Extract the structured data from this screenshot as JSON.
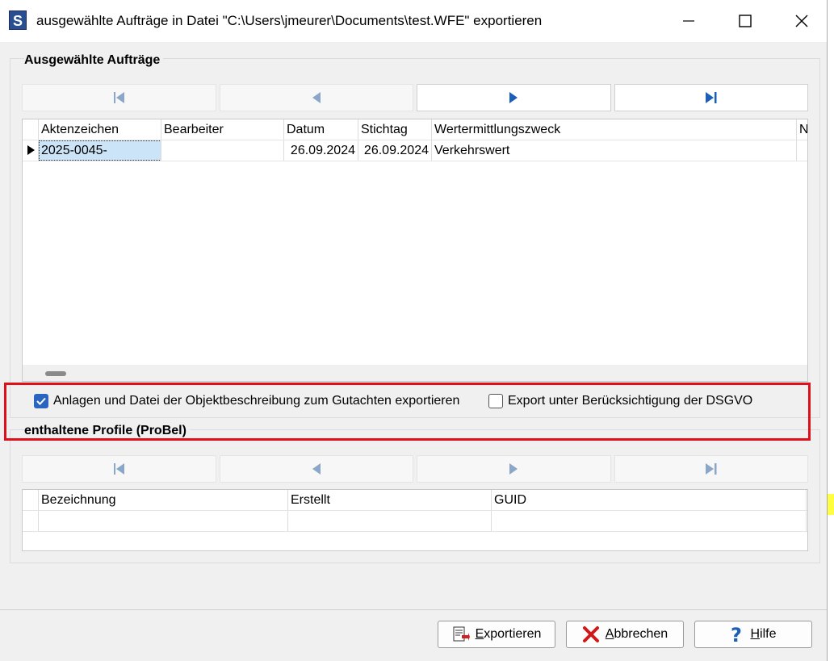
{
  "window": {
    "title": "ausgewählte Aufträge in Datei \"C:\\Users\\jmeurer\\Documents\\test.WFE\" exportieren",
    "app_icon_letter": "S"
  },
  "auftraege": {
    "section_title": "Ausgewählte Aufträge",
    "columns": [
      "Aktenzeichen",
      "Bearbeiter",
      "Datum",
      "Stichtag",
      "Wertermittlungszweck",
      "N"
    ],
    "rows": [
      {
        "aktenzeichen": "2025-0045-",
        "bearbeiter": "",
        "datum": "26.09.2024",
        "stichtag": "26.09.2024",
        "zweck": "Verkehrswert",
        "n": ""
      }
    ]
  },
  "options": {
    "export_anlagen": {
      "label": "Anlagen und Datei der Objektbeschreibung zum Gutachten exportieren",
      "checked": true
    },
    "export_dsgvo": {
      "label": "Export unter Berücksichtigung der DSGVO",
      "checked": false
    }
  },
  "profile": {
    "section_title": "enthaltene Profile (ProBel)",
    "columns": [
      "Bezeichnung",
      "Erstellt",
      "GUID"
    ]
  },
  "buttons": {
    "export": {
      "pre": "",
      "key": "E",
      "post": "xportieren"
    },
    "cancel": {
      "pre": "",
      "key": "A",
      "post": "bbrechen"
    },
    "help": {
      "pre": "",
      "key": "H",
      "post": "ilfe"
    }
  },
  "colors": {
    "accent": "#1c5fb8",
    "highlight_border": "#e0101a",
    "selection": "#cce4f7"
  }
}
